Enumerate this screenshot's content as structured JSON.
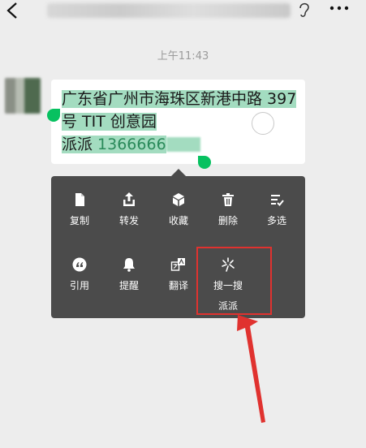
{
  "header": {
    "back_icon": "chevron-left-icon",
    "ear_icon": "ear-icon",
    "more_icon": "more-horizontal-icon"
  },
  "time": "上午11:43",
  "message": {
    "line1": "广东省广州市海珠区新港中路 397",
    "line2": "号 TIT 创意园",
    "line3_prefix": "派派 ",
    "line3_number": "1366666"
  },
  "menu": {
    "items": [
      {
        "label": "复制",
        "icon": "copy-icon"
      },
      {
        "label": "转发",
        "icon": "forward-icon"
      },
      {
        "label": "收藏",
        "icon": "favorite-cube-icon"
      },
      {
        "label": "删除",
        "icon": "trash-icon"
      },
      {
        "label": "多选",
        "icon": "multi-select-icon"
      },
      {
        "label": "引用",
        "icon": "quote-icon"
      },
      {
        "label": "提醒",
        "icon": "bell-icon"
      },
      {
        "label": "翻译",
        "icon": "translate-icon"
      },
      {
        "label": "搜一搜",
        "sub": "派派",
        "icon": "sparkle-search-icon"
      }
    ]
  },
  "colors": {
    "highlight": "#a3dcc0",
    "handle": "#07c160",
    "menu_bg": "#4b4b4b",
    "annotation": "#e0322f"
  }
}
